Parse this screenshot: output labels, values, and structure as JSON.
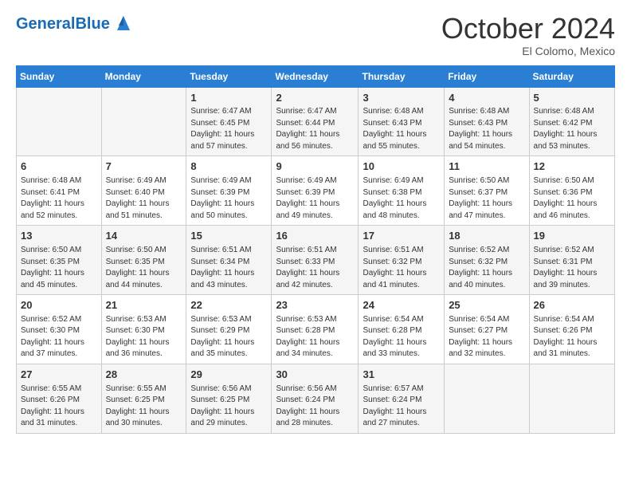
{
  "header": {
    "logo_general": "General",
    "logo_blue": "Blue",
    "month_title": "October 2024",
    "location": "El Colomo, Mexico"
  },
  "days_of_week": [
    "Sunday",
    "Monday",
    "Tuesday",
    "Wednesday",
    "Thursday",
    "Friday",
    "Saturday"
  ],
  "weeks": [
    [
      {
        "day": "",
        "info": ""
      },
      {
        "day": "",
        "info": ""
      },
      {
        "day": "1",
        "info": "Sunrise: 6:47 AM\nSunset: 6:45 PM\nDaylight: 11 hours and 57 minutes."
      },
      {
        "day": "2",
        "info": "Sunrise: 6:47 AM\nSunset: 6:44 PM\nDaylight: 11 hours and 56 minutes."
      },
      {
        "day": "3",
        "info": "Sunrise: 6:48 AM\nSunset: 6:43 PM\nDaylight: 11 hours and 55 minutes."
      },
      {
        "day": "4",
        "info": "Sunrise: 6:48 AM\nSunset: 6:43 PM\nDaylight: 11 hours and 54 minutes."
      },
      {
        "day": "5",
        "info": "Sunrise: 6:48 AM\nSunset: 6:42 PM\nDaylight: 11 hours and 53 minutes."
      }
    ],
    [
      {
        "day": "6",
        "info": "Sunrise: 6:48 AM\nSunset: 6:41 PM\nDaylight: 11 hours and 52 minutes."
      },
      {
        "day": "7",
        "info": "Sunrise: 6:49 AM\nSunset: 6:40 PM\nDaylight: 11 hours and 51 minutes."
      },
      {
        "day": "8",
        "info": "Sunrise: 6:49 AM\nSunset: 6:39 PM\nDaylight: 11 hours and 50 minutes."
      },
      {
        "day": "9",
        "info": "Sunrise: 6:49 AM\nSunset: 6:39 PM\nDaylight: 11 hours and 49 minutes."
      },
      {
        "day": "10",
        "info": "Sunrise: 6:49 AM\nSunset: 6:38 PM\nDaylight: 11 hours and 48 minutes."
      },
      {
        "day": "11",
        "info": "Sunrise: 6:50 AM\nSunset: 6:37 PM\nDaylight: 11 hours and 47 minutes."
      },
      {
        "day": "12",
        "info": "Sunrise: 6:50 AM\nSunset: 6:36 PM\nDaylight: 11 hours and 46 minutes."
      }
    ],
    [
      {
        "day": "13",
        "info": "Sunrise: 6:50 AM\nSunset: 6:35 PM\nDaylight: 11 hours and 45 minutes."
      },
      {
        "day": "14",
        "info": "Sunrise: 6:50 AM\nSunset: 6:35 PM\nDaylight: 11 hours and 44 minutes."
      },
      {
        "day": "15",
        "info": "Sunrise: 6:51 AM\nSunset: 6:34 PM\nDaylight: 11 hours and 43 minutes."
      },
      {
        "day": "16",
        "info": "Sunrise: 6:51 AM\nSunset: 6:33 PM\nDaylight: 11 hours and 42 minutes."
      },
      {
        "day": "17",
        "info": "Sunrise: 6:51 AM\nSunset: 6:32 PM\nDaylight: 11 hours and 41 minutes."
      },
      {
        "day": "18",
        "info": "Sunrise: 6:52 AM\nSunset: 6:32 PM\nDaylight: 11 hours and 40 minutes."
      },
      {
        "day": "19",
        "info": "Sunrise: 6:52 AM\nSunset: 6:31 PM\nDaylight: 11 hours and 39 minutes."
      }
    ],
    [
      {
        "day": "20",
        "info": "Sunrise: 6:52 AM\nSunset: 6:30 PM\nDaylight: 11 hours and 37 minutes."
      },
      {
        "day": "21",
        "info": "Sunrise: 6:53 AM\nSunset: 6:30 PM\nDaylight: 11 hours and 36 minutes."
      },
      {
        "day": "22",
        "info": "Sunrise: 6:53 AM\nSunset: 6:29 PM\nDaylight: 11 hours and 35 minutes."
      },
      {
        "day": "23",
        "info": "Sunrise: 6:53 AM\nSunset: 6:28 PM\nDaylight: 11 hours and 34 minutes."
      },
      {
        "day": "24",
        "info": "Sunrise: 6:54 AM\nSunset: 6:28 PM\nDaylight: 11 hours and 33 minutes."
      },
      {
        "day": "25",
        "info": "Sunrise: 6:54 AM\nSunset: 6:27 PM\nDaylight: 11 hours and 32 minutes."
      },
      {
        "day": "26",
        "info": "Sunrise: 6:54 AM\nSunset: 6:26 PM\nDaylight: 11 hours and 31 minutes."
      }
    ],
    [
      {
        "day": "27",
        "info": "Sunrise: 6:55 AM\nSunset: 6:26 PM\nDaylight: 11 hours and 31 minutes."
      },
      {
        "day": "28",
        "info": "Sunrise: 6:55 AM\nSunset: 6:25 PM\nDaylight: 11 hours and 30 minutes."
      },
      {
        "day": "29",
        "info": "Sunrise: 6:56 AM\nSunset: 6:25 PM\nDaylight: 11 hours and 29 minutes."
      },
      {
        "day": "30",
        "info": "Sunrise: 6:56 AM\nSunset: 6:24 PM\nDaylight: 11 hours and 28 minutes."
      },
      {
        "day": "31",
        "info": "Sunrise: 6:57 AM\nSunset: 6:24 PM\nDaylight: 11 hours and 27 minutes."
      },
      {
        "day": "",
        "info": ""
      },
      {
        "day": "",
        "info": ""
      }
    ]
  ]
}
